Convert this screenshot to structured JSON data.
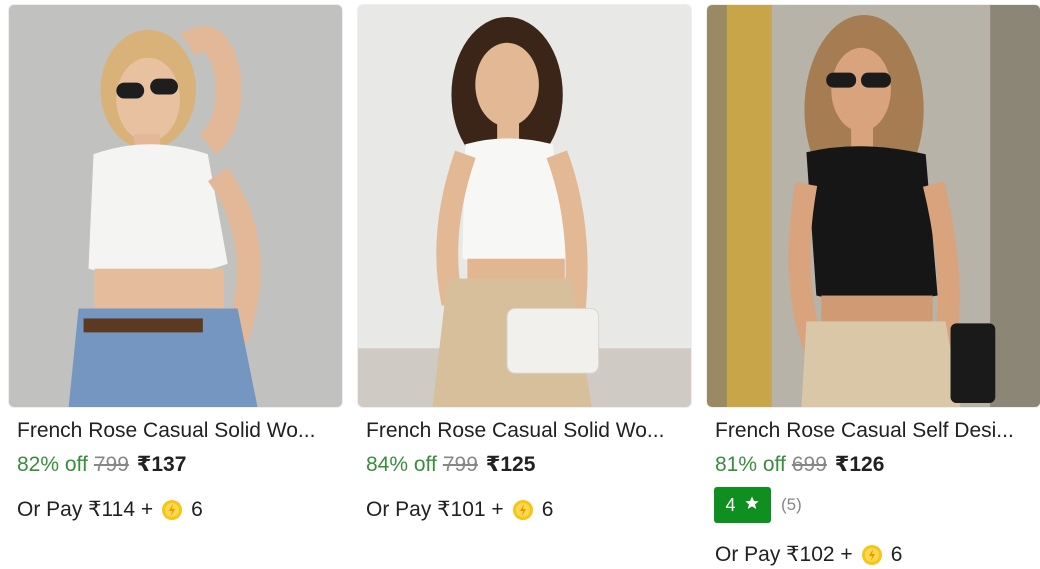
{
  "products": [
    {
      "title": "French Rose Casual Solid Wo...",
      "discount": "82% off",
      "mrp": "799",
      "price": "₹137",
      "or_pay_prefix": "Or Pay ₹114 +",
      "coins": "6",
      "image_icon": "product-image"
    },
    {
      "title": "French Rose Casual Solid Wo...",
      "discount": "84% off",
      "mrp": "799",
      "price": "₹125",
      "or_pay_prefix": "Or Pay ₹101 +",
      "coins": "6",
      "image_icon": "product-image"
    },
    {
      "title": "French Rose Casual Self Desi...",
      "discount": "81% off",
      "mrp": "699",
      "price": "₹126",
      "rating": "4",
      "rating_count": "(5)",
      "or_pay_prefix": "Or Pay ₹102 +",
      "coins": "6",
      "image_icon": "product-image"
    }
  ],
  "colors": {
    "discount": "#388e3c",
    "rating_badge": "#0e8f1f",
    "coin": "#f5c518"
  }
}
